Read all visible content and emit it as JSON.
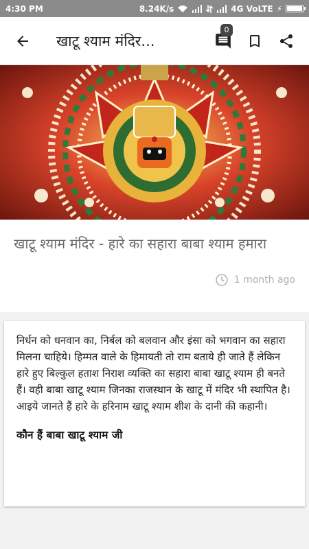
{
  "status_bar": {
    "time": "4:30 PM",
    "network_speed": "8.24K/s",
    "network_type": "4G VoLTE",
    "battery_level": 1.0
  },
  "app_bar": {
    "back_icon": "arrow-left-icon",
    "title": "खाटू श्याम मंदिर...",
    "comments_icon": "comment-icon",
    "comment_count": "0",
    "bookmark_icon": "bookmark-icon",
    "share_icon": "share-icon"
  },
  "hero_image": {
    "description": "decorated deity idol"
  },
  "article": {
    "headline": "खाटू श्याम मंदिर - हारे का सहारा बाबा श्याम हमारा",
    "time_icon": "clock-icon",
    "published": "1 month ago",
    "body": "निर्धन को धनवान का, निर्बल को बलवान और इंसा को भगवान का सहारा मिलना चाहिये। हिम्मत वाले के हिमायती तो राम बताये ही जाते हैं लेकिन हारे हुए बिल्कुल हताश निराश व्यक्ति का सहारा बाबा खाटू श्याम ही बनते हैं। वही बाबा खाटू श्याम जिनका राजस्थान के खाटू में मंदिर भी स्थापित है। आइये जानते हैं हारे के हरिनाम खाटू श्याम शीश के दानी की कहानी।",
    "subheading": "कौन हैं बाबा खाटू श्याम जी"
  }
}
